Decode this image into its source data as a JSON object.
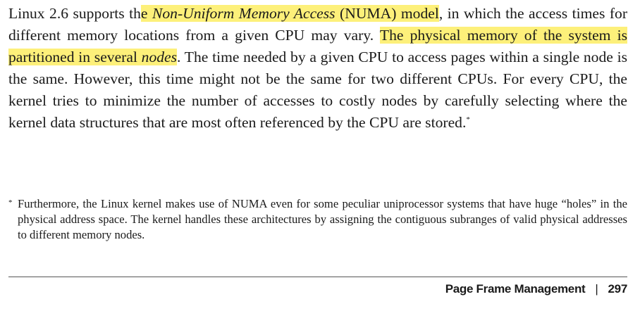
{
  "paragraph": {
    "seg1": "Linux 2.6 supports th",
    "seg2": "e ",
    "seg3": "Non-Uniform Memory Access",
    "seg4": " (NUMA) model",
    "seg5": ", in which the access times for different memory locations from a given CPU may vary. ",
    "seg6": "The physi­cal memory of the system is partitioned in several ",
    "seg7": "nodes",
    "seg8": ". The time needed by a given CPU to access pages within a single node is the same. However, this time might not be the same for two different CPUs. For every CPU, the kernel tries to minimize the number of accesses to costly nodes by carefully selecting where the kernel data struc­tures that are most often referenced by the CPU are stored.",
    "footnote_marker": "*"
  },
  "footnote": {
    "marker": "*",
    "text": "Furthermore, the Linux kernel makes use of NUMA even for some peculiar uniprocessor systems that have huge “holes” in the physical address space. The kernel handles these architectures by assigning the contigu­ous subranges of valid physical addresses to different memory nodes."
  },
  "footer": {
    "section": "Page Frame Management",
    "separator": "|",
    "page_number": "297"
  },
  "colors": {
    "highlight": "#fdf07a",
    "text": "#1a1a1a"
  }
}
